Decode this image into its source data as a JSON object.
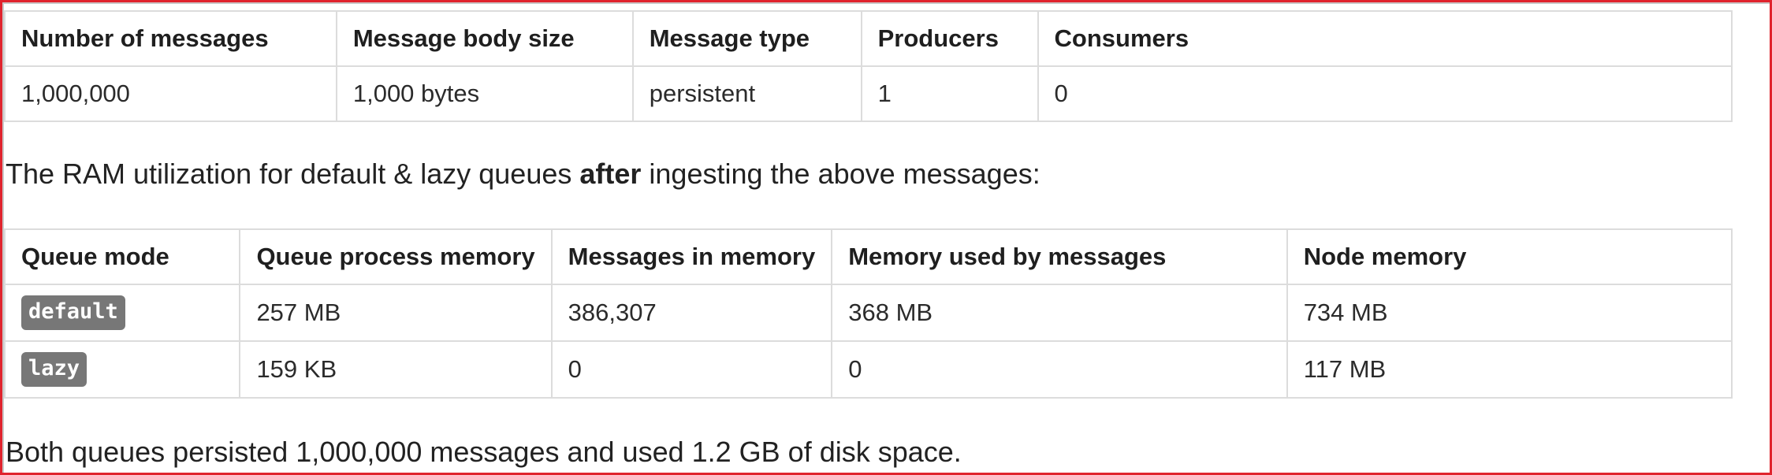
{
  "table1": {
    "headers": [
      "Number of messages",
      "Message body size",
      "Message type",
      "Producers",
      "Consumers"
    ],
    "row": [
      "1,000,000",
      "1,000 bytes",
      "persistent",
      "1",
      "0"
    ]
  },
  "paragraph1": {
    "before": "The RAM utilization for default & lazy queues ",
    "bold": "after",
    "after": " ingesting the above messages:"
  },
  "table2": {
    "headers": [
      "Queue mode",
      "Queue process memory",
      "Messages in memory",
      "Memory used by messages",
      "Node memory"
    ],
    "rows": [
      {
        "mode": "default",
        "process_memory": "257 MB",
        "messages_in_memory": "386,307",
        "memory_used": "368 MB",
        "node_memory": "734 MB"
      },
      {
        "mode": "lazy",
        "process_memory": "159 KB",
        "messages_in_memory": "0",
        "memory_used": "0",
        "node_memory": "117 MB"
      }
    ]
  },
  "paragraph2": {
    "text": "Both queues persisted 1,000,000 messages and used 1.2 GB of disk space."
  },
  "colors": {
    "frame_border": "#e0242e",
    "table_border": "#dcdcdc",
    "code_badge_bg": "#777777"
  }
}
